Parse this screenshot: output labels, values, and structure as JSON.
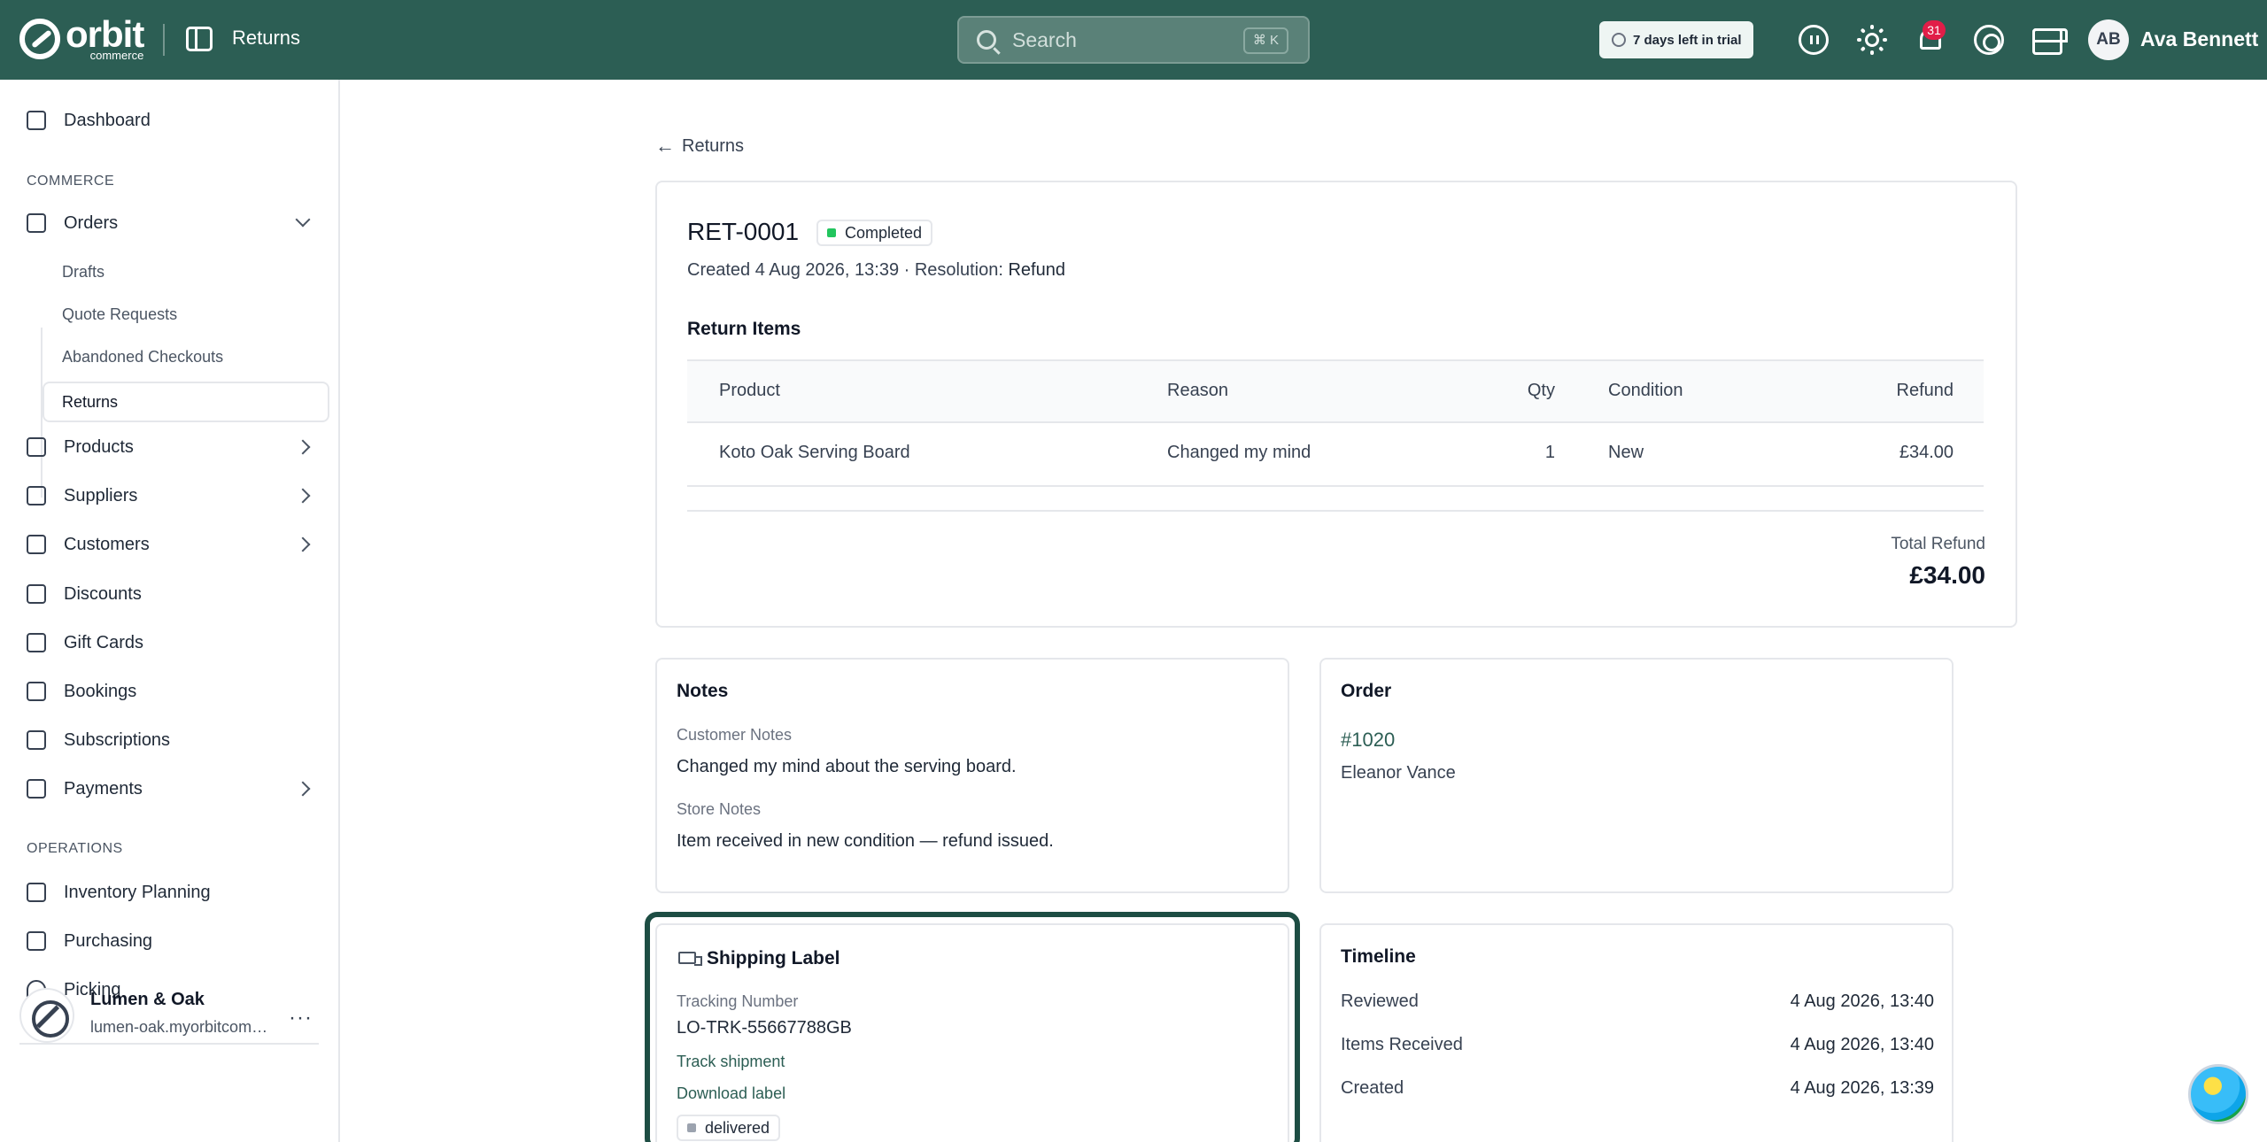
{
  "topbar": {
    "logo_text": "orbit",
    "logo_sub": "commerce",
    "page_title": "Returns",
    "search_placeholder": "Search",
    "search_shortcut": "⌘ K",
    "trial_text": "7 days left in trial",
    "notifications_count": "31",
    "user_initials": "AB",
    "user_name": "Ava Bennett"
  },
  "sidebar": {
    "dashboard": "Dashboard",
    "section_commerce": "COMMERCE",
    "orders": "Orders",
    "orders_sub": [
      "Drafts",
      "Quote Requests",
      "Abandoned Checkouts",
      "Returns"
    ],
    "products": "Products",
    "suppliers": "Suppliers",
    "customers": "Customers",
    "discounts": "Discounts",
    "gift_cards": "Gift Cards",
    "bookings": "Bookings",
    "subscriptions": "Subscriptions",
    "payments": "Payments",
    "section_operations": "OPERATIONS",
    "inventory_planning": "Inventory Planning",
    "purchasing": "Purchasing",
    "picking": "Picking",
    "store_name": "Lumen & Oak",
    "store_url": "lumen-oak.myorbitcommerce.com",
    "store_menu": "···"
  },
  "main": {
    "back_label": "Returns",
    "return_id": "RET-0001",
    "status": "Completed",
    "created_prefix": "Created 4 Aug 2026, 13:39 · Resolution: ",
    "resolution": "Refund",
    "items_heading": "Return Items",
    "columns": {
      "product": "Product",
      "reason": "Reason",
      "qty": "Qty",
      "condition": "Condition",
      "refund": "Refund"
    },
    "items": [
      {
        "product": "Koto Oak Serving Board",
        "reason": "Changed my mind",
        "qty": "1",
        "condition": "New",
        "refund": "£34.00"
      }
    ],
    "total_label": "Total Refund",
    "total_value": "£34.00"
  },
  "notes": {
    "title": "Notes",
    "customer_label": "Customer Notes",
    "customer_text": "Changed my mind about the serving board.",
    "store_label": "Store Notes",
    "store_text": "Item received in new condition — refund issued."
  },
  "order": {
    "title": "Order",
    "number": "#1020",
    "customer": "Eleanor Vance"
  },
  "shipping": {
    "title": "Shipping Label",
    "tracking_label": "Tracking Number",
    "tracking_number": "LO-TRK-55667788GB",
    "track_link": "Track shipment",
    "download_link": "Download label",
    "status": "delivered"
  },
  "timeline": {
    "title": "Timeline",
    "events": [
      {
        "label": "Reviewed",
        "date": "4 Aug 2026, 13:40"
      },
      {
        "label": "Items Received",
        "date": "4 Aug 2026, 13:40"
      },
      {
        "label": "Created",
        "date": "4 Aug 2026, 13:39"
      }
    ]
  }
}
